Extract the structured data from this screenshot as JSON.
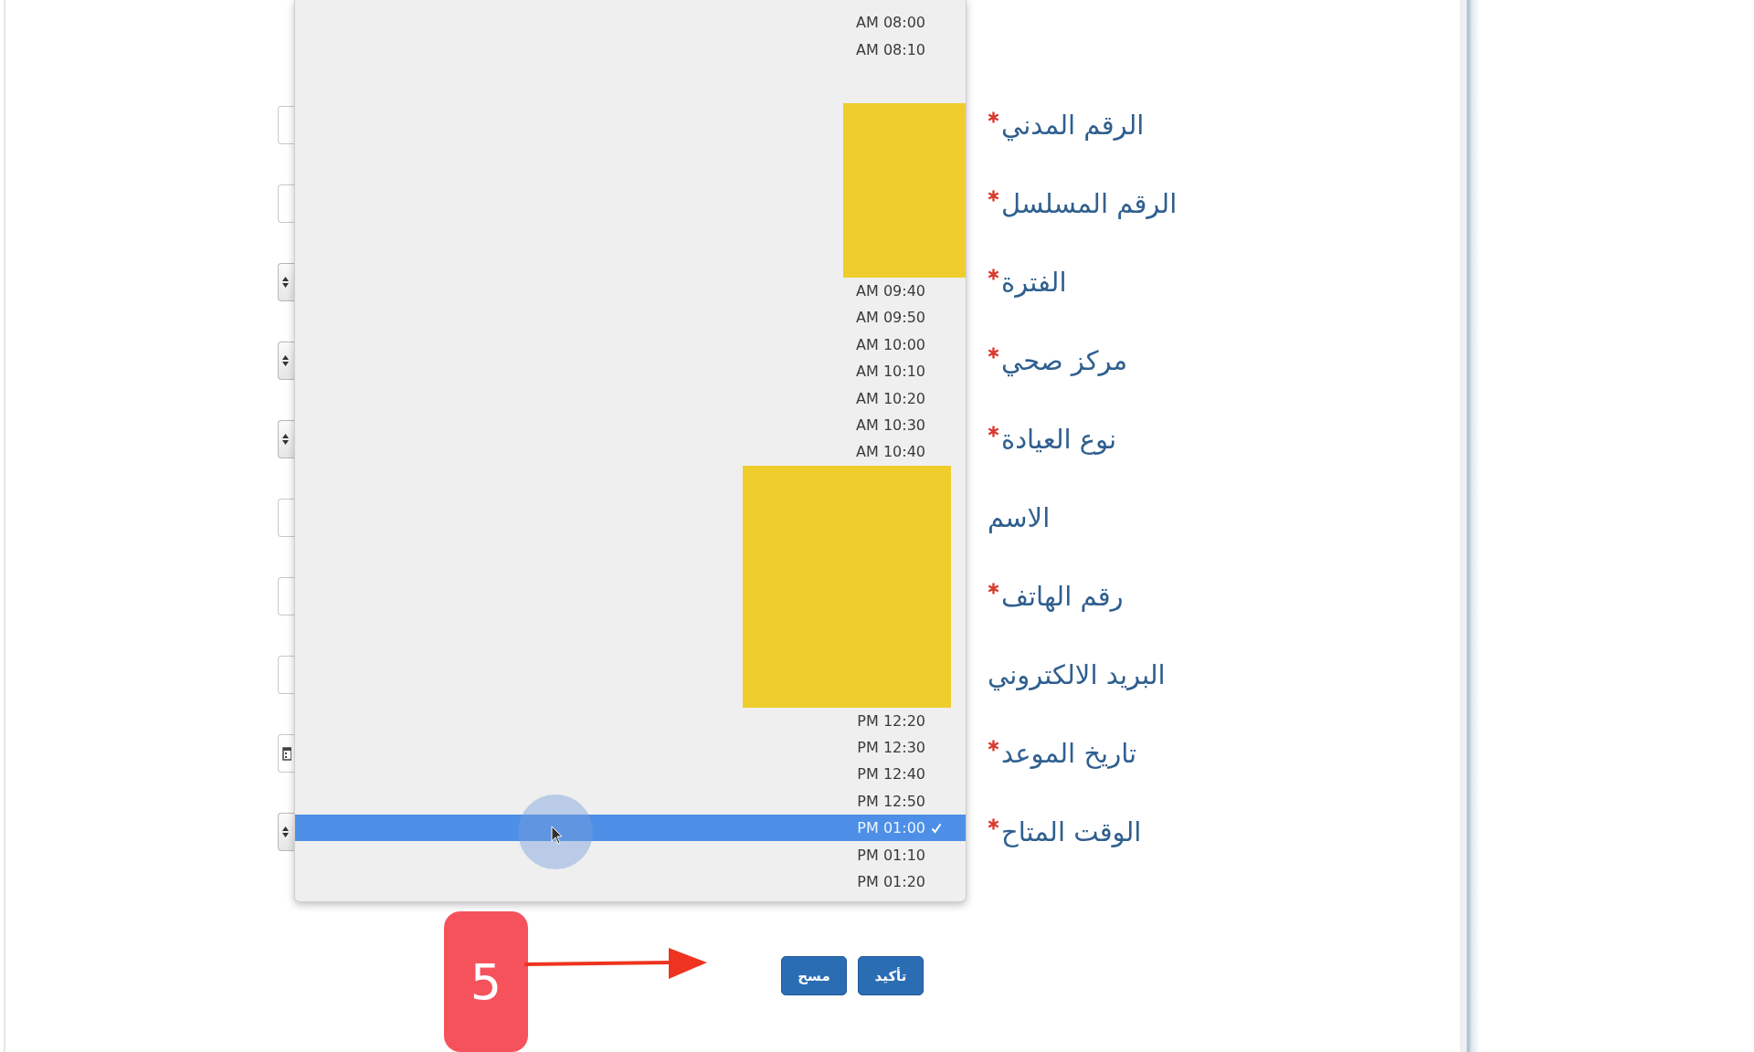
{
  "form": {
    "fields": [
      {
        "label": "الرقم المدني",
        "required": true,
        "kind": "text"
      },
      {
        "label": "الرقم المسلسل",
        "required": true,
        "kind": "text"
      },
      {
        "label": "الفترة",
        "required": true,
        "kind": "select"
      },
      {
        "label": "مركز صحي",
        "required": true,
        "kind": "select"
      },
      {
        "label": "نوع العيادة",
        "required": true,
        "kind": "select"
      },
      {
        "label": "الاسم",
        "required": false,
        "kind": "text"
      },
      {
        "label": "رقم الهاتف",
        "required": true,
        "kind": "text"
      },
      {
        "label": "البريد الالكتروني",
        "required": false,
        "kind": "text"
      },
      {
        "label": "تاريخ الموعد",
        "required": true,
        "kind": "date"
      },
      {
        "label": "الوقت المتاح",
        "required": true,
        "kind": "select"
      }
    ]
  },
  "time_dropdown": {
    "options": [
      {
        "kind": "option",
        "text": "AM 08:00",
        "selected": false
      },
      {
        "kind": "option",
        "text": "AM 08:10",
        "selected": false
      },
      {
        "kind": "cover"
      },
      {
        "kind": "option",
        "text": "AM 09:40",
        "selected": false
      },
      {
        "kind": "option",
        "text": "AM 09:50",
        "selected": false
      },
      {
        "kind": "option",
        "text": "AM 10:00",
        "selected": false
      },
      {
        "kind": "option",
        "text": "AM 10:10",
        "selected": false
      },
      {
        "kind": "option",
        "text": "AM 10:20",
        "selected": false
      },
      {
        "kind": "option",
        "text": "AM 10:30",
        "selected": false
      },
      {
        "kind": "option",
        "text": "AM 10:40",
        "selected": false
      },
      {
        "kind": "cover"
      },
      {
        "kind": "option",
        "text": "PM 12:20",
        "selected": false
      },
      {
        "kind": "option",
        "text": "PM 12:30",
        "selected": false
      },
      {
        "kind": "option",
        "text": "PM 12:40",
        "selected": false
      },
      {
        "kind": "option",
        "text": "PM 12:50",
        "selected": false
      },
      {
        "kind": "option",
        "text": "PM 01:00",
        "selected": true
      },
      {
        "kind": "option",
        "text": "PM 01:10",
        "selected": false
      },
      {
        "kind": "option",
        "text": "PM 01:20",
        "selected": false
      }
    ]
  },
  "buttons": [
    {
      "label": "تأكيد"
    },
    {
      "label": "مسح"
    }
  ],
  "annotation": {
    "step": "5"
  }
}
